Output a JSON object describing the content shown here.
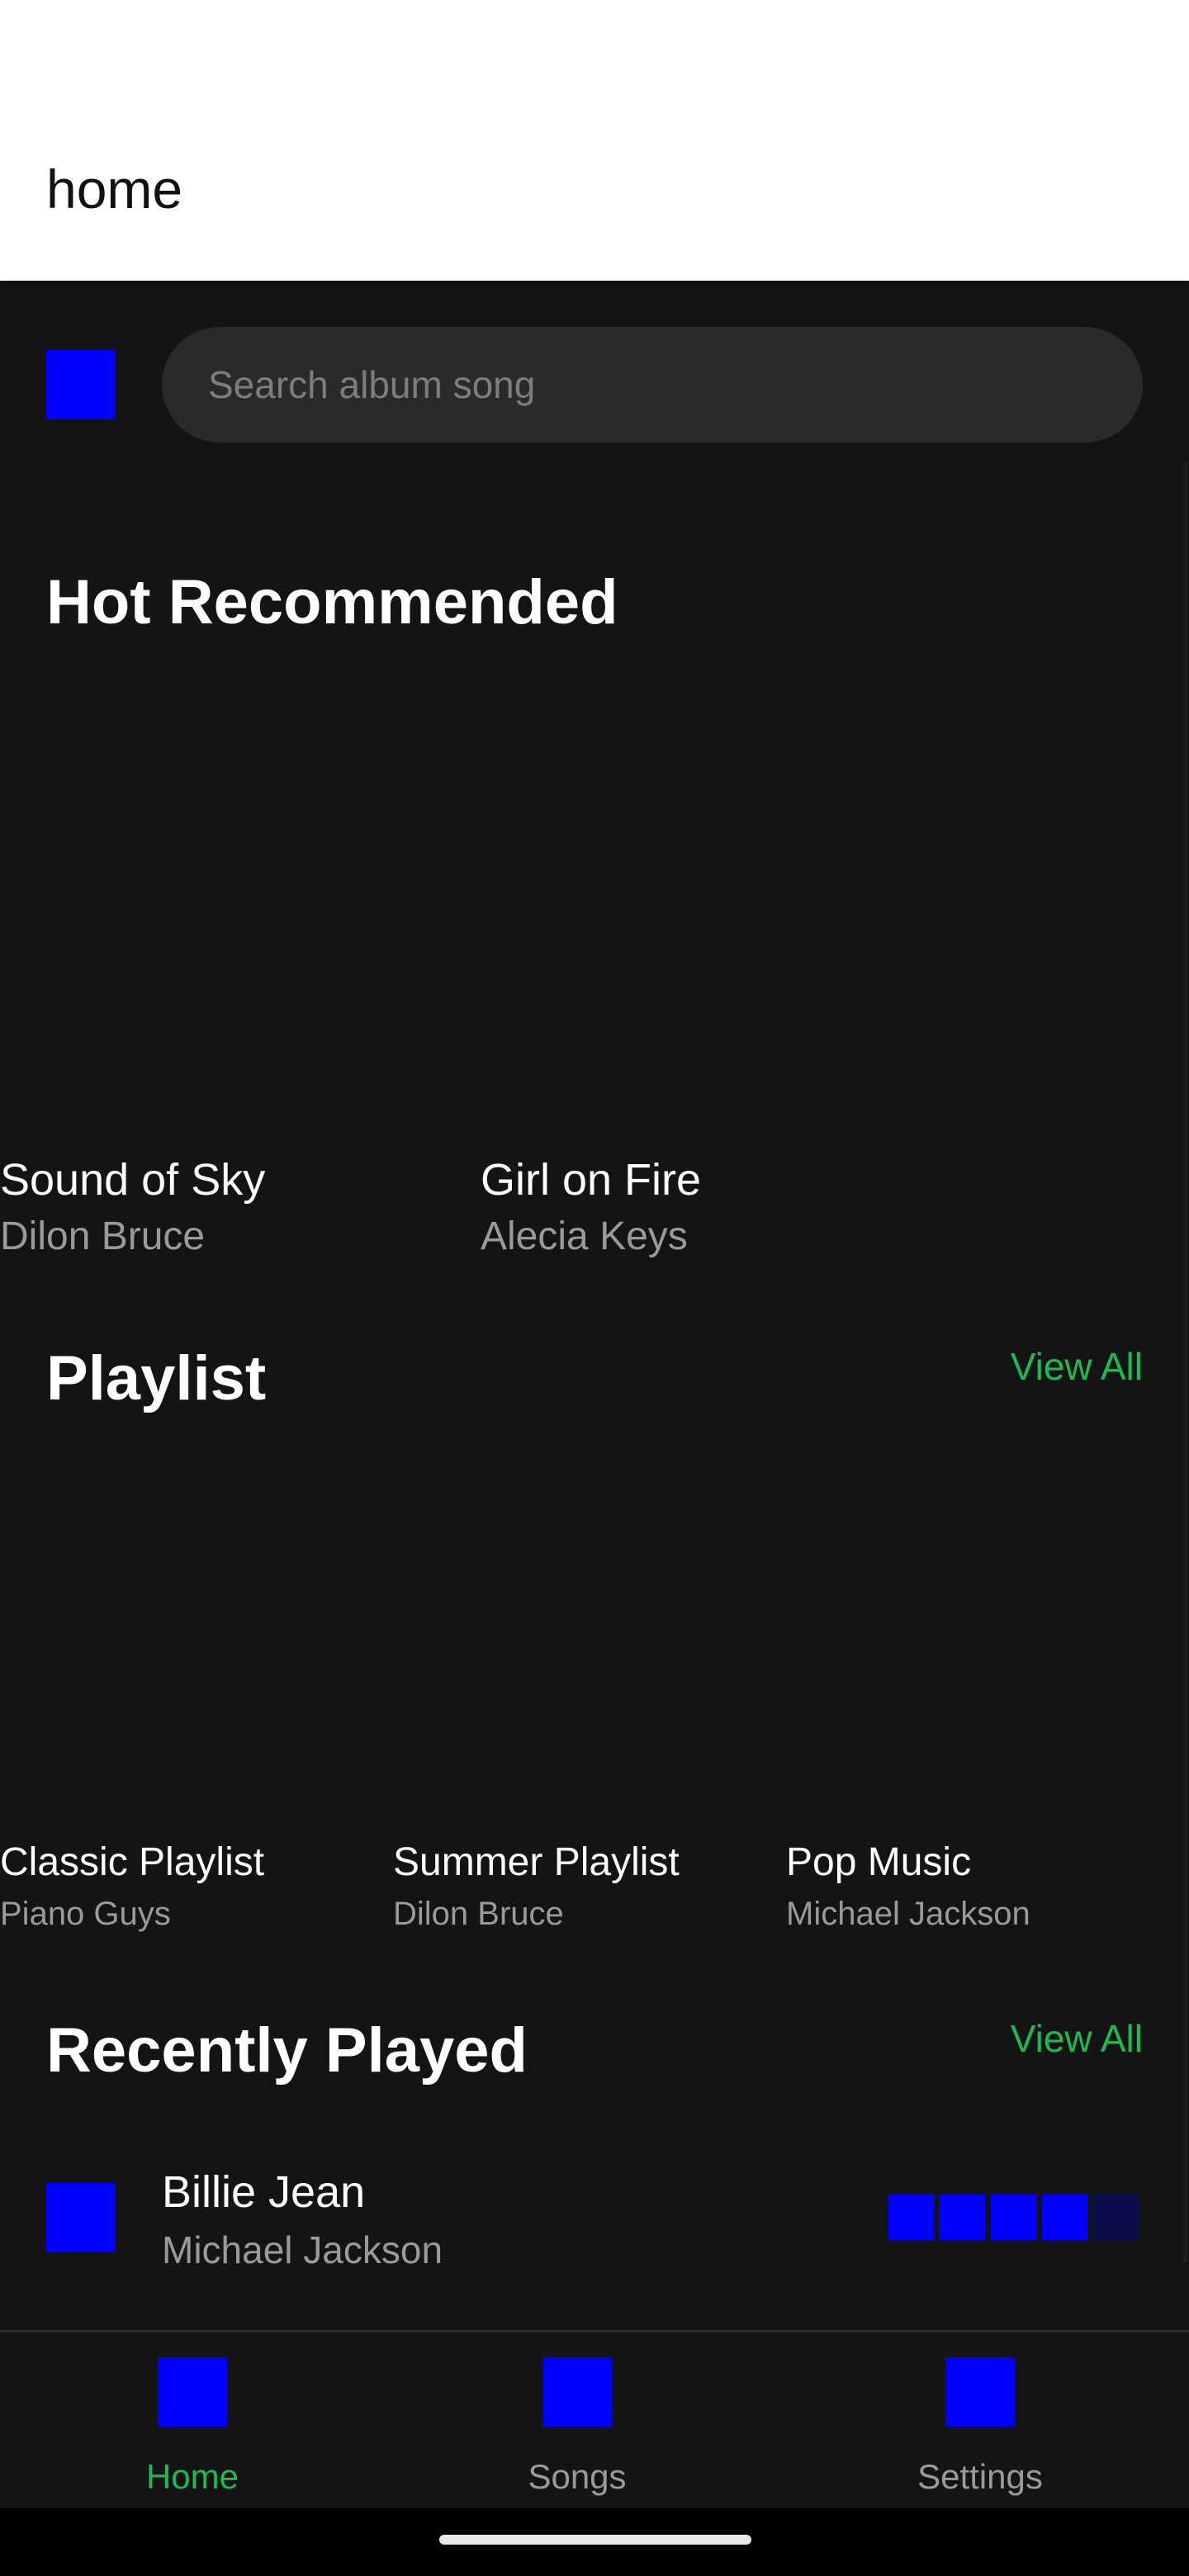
{
  "app_bar": {
    "title": "home"
  },
  "search": {
    "placeholder": "Search album song",
    "value": ""
  },
  "hot_recommended": {
    "title": "Hot Recommended",
    "items": [
      {
        "title": "Sound of Sky",
        "artist": "Dilon Bruce"
      },
      {
        "title": "Girl on Fire",
        "artist": "Alecia Keys"
      }
    ]
  },
  "playlist": {
    "title": "Playlist",
    "view_all": "View All",
    "items": [
      {
        "title": "Classic Playlist",
        "artist": "Piano Guys"
      },
      {
        "title": "Summer Playlist",
        "artist": "Dilon Bruce"
      },
      {
        "title": "Pop Music",
        "artist": "Michael Jackson"
      }
    ]
  },
  "recently_played": {
    "title": "Recently Played",
    "view_all": "View All",
    "items": [
      {
        "title": "Billie Jean",
        "artist": "Michael Jackson",
        "rating": 4,
        "rating_max": 5
      }
    ]
  },
  "bottom_nav": {
    "items": [
      {
        "label": "Home",
        "icon": "home-icon",
        "active": true
      },
      {
        "label": "Songs",
        "icon": "songs-icon",
        "active": false
      },
      {
        "label": "Settings",
        "icon": "settings-icon",
        "active": false
      }
    ]
  },
  "colors": {
    "background": "#141414",
    "app_bar": "#ffffff",
    "accent": "#1fb954",
    "icon_placeholder": "#0000ff",
    "rating_off": "#0c0c4a",
    "secondary_text": "#9a9a9a",
    "nav_inactive": "#9a9a9a"
  }
}
